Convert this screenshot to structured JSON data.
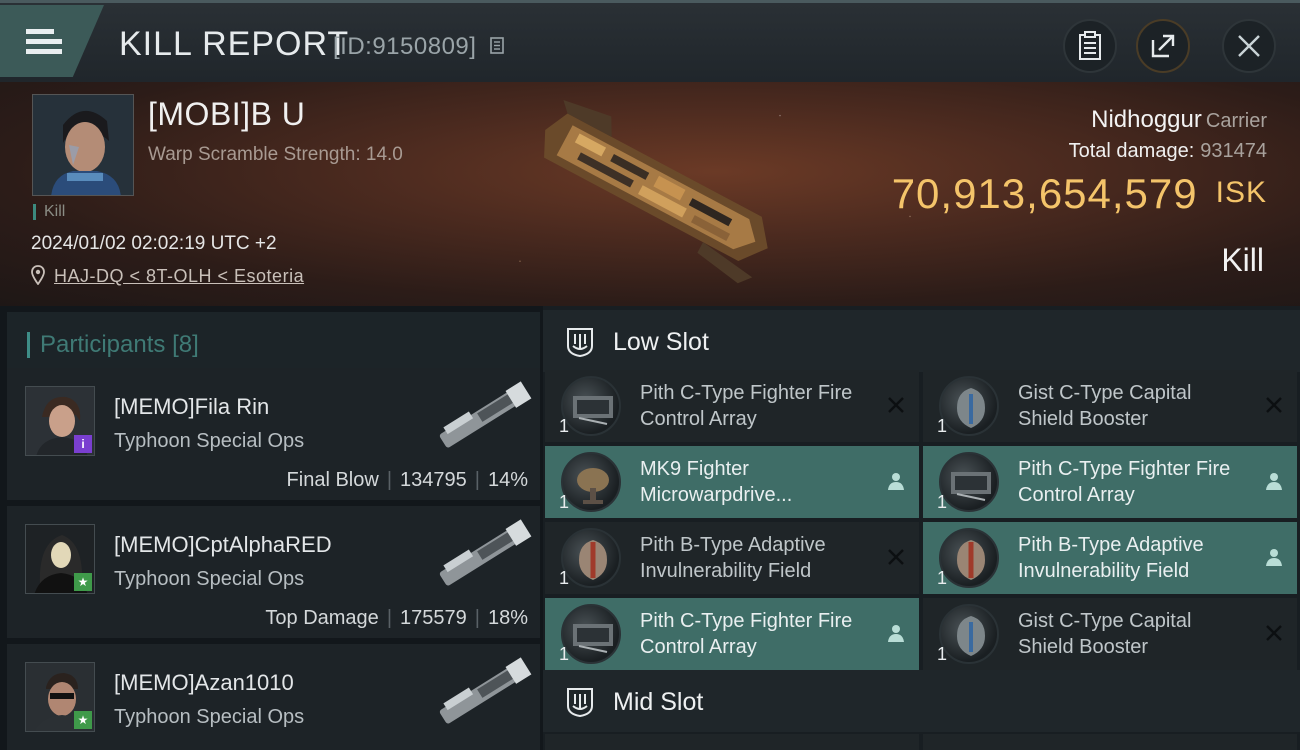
{
  "header": {
    "title": "KILL REPORT",
    "id_text": "[ID:9150809]"
  },
  "victim": {
    "name": "[MOBI]B U",
    "warp_scramble": "Warp Scramble Strength: 14.0",
    "kill_tag": "Kill",
    "datetime": "2024/01/02 02:02:19 UTC +2",
    "location": "HAJ-DQ < 8T-OLH < Esoteria",
    "ship_name": "Nidhoggur",
    "ship_class": "Carrier",
    "total_damage_label": "Total damage:",
    "total_damage": "931474",
    "isk_value": "70,913,654,579",
    "isk_unit": "ISK",
    "result": "Kill"
  },
  "participants": {
    "title": "Participants",
    "count": "[8]",
    "items": [
      {
        "name": "[MEMO]Fila Rin",
        "ship": "Typhoon Special Ops",
        "role": "Final Blow",
        "damage": "134795",
        "percent": "14%",
        "badge": "i",
        "badge_color": "#7a3fd0"
      },
      {
        "name": "[MEMO]CptAlphaRED",
        "ship": "Typhoon Special Ops",
        "role": "Top Damage",
        "damage": "175579",
        "percent": "18%",
        "badge": "★",
        "badge_color": "#3f9a4a"
      },
      {
        "name": "[MEMO]Azan1010",
        "ship": "Typhoon Special Ops",
        "role": "",
        "damage": "",
        "percent": "",
        "badge": "★",
        "badge_color": "#3f9a4a"
      }
    ]
  },
  "low_slot": {
    "label": "Low Slot",
    "modules": [
      {
        "name": "Pith C-Type Fighter Fire Control Array",
        "qty": "1",
        "state": "destroyed"
      },
      {
        "name": "Gist C-Type Capital Shield Booster",
        "qty": "1",
        "state": "destroyed"
      },
      {
        "name": "MK9 Fighter Microwarpdrive...",
        "qty": "1",
        "state": "dropped"
      },
      {
        "name": "Pith C-Type Fighter Fire Control Array",
        "qty": "1",
        "state": "dropped"
      },
      {
        "name": "Pith B-Type Adaptive Invulnerability Field",
        "qty": "1",
        "state": "destroyed"
      },
      {
        "name": "Pith B-Type Adaptive Invulnerability Field",
        "qty": "1",
        "state": "dropped"
      },
      {
        "name": "Pith C-Type Fighter Fire Control Array",
        "qty": "1",
        "state": "dropped"
      },
      {
        "name": "Gist C-Type Capital Shield Booster",
        "qty": "1",
        "state": "destroyed"
      }
    ]
  },
  "mid_slot": {
    "label": "Mid Slot"
  },
  "colors": {
    "accent_teal": "#3f6d67",
    "isk_gold": "#f4c46a",
    "participants_teal": "#3f7a75"
  }
}
